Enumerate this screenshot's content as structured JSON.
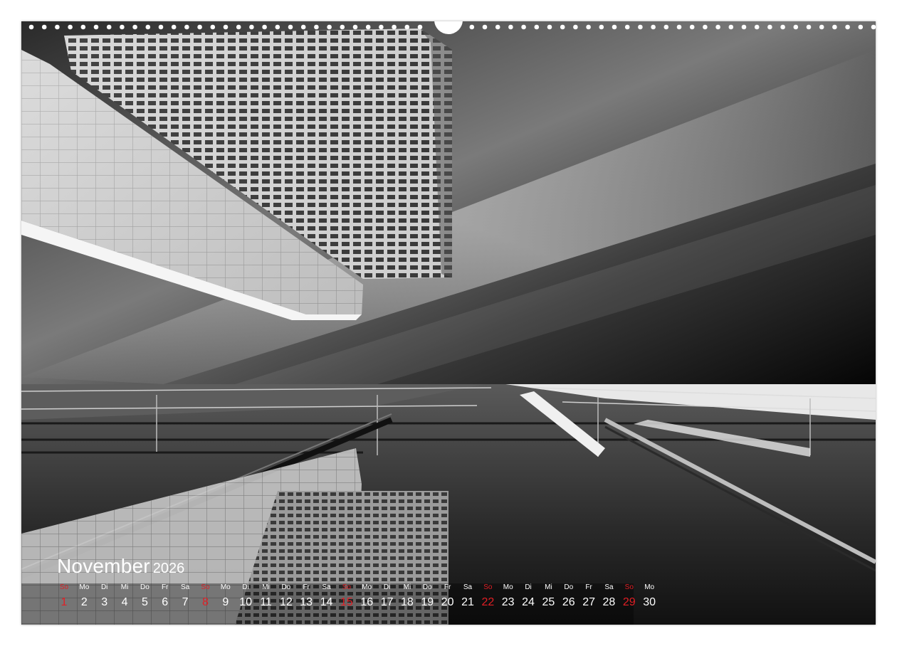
{
  "calendar": {
    "month": "November",
    "year": "2026",
    "weekday_labels": [
      "So",
      "Mo",
      "Di",
      "Mi",
      "Do",
      "Fr",
      "Sa",
      "So",
      "Mo",
      "Di",
      "Mi",
      "Do",
      "Fr",
      "Sa",
      "So",
      "Mo",
      "Di",
      "Mi",
      "Do",
      "Fr",
      "Sa",
      "So",
      "Mo",
      "Di",
      "Mi",
      "Do",
      "Fr",
      "Sa",
      "So",
      "Mo"
    ],
    "days": [
      "1",
      "2",
      "3",
      "4",
      "5",
      "6",
      "7",
      "8",
      "9",
      "10",
      "11",
      "12",
      "13",
      "14",
      "15",
      "16",
      "17",
      "18",
      "19",
      "20",
      "21",
      "22",
      "23",
      "24",
      "25",
      "26",
      "27",
      "28",
      "29",
      "30"
    ],
    "sunday_color": "#e11f25",
    "text_color": "#ffffff"
  },
  "photo": {
    "palette": "black-and-white",
    "icon": "architecture-photo"
  }
}
